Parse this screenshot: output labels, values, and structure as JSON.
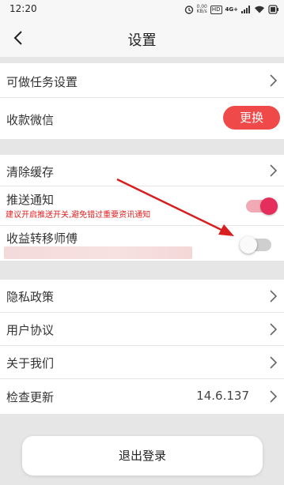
{
  "status_bar": {
    "time": "12:20",
    "speed_value": "0.00",
    "speed_unit": "KB/s",
    "hd_label": "HD",
    "network_label": "4G+"
  },
  "header": {
    "title": "设置",
    "back_icon": "chevron-left-icon"
  },
  "section1": {
    "task_settings_label": "可做任务设置",
    "wechat_label": "收款微信",
    "change_button_label": "更换"
  },
  "section2": {
    "clear_cache_label": "清除缓存",
    "push_label": "推送通知",
    "push_hint": "建议开启推送开关,避免错过重要资讯通知",
    "push_enabled": true,
    "transfer_label": "收益转移师傅",
    "transfer_enabled": false
  },
  "section3": {
    "privacy_label": "隐私政策",
    "agreement_label": "用户协议",
    "about_label": "关于我们",
    "update_label": "检查更新",
    "version": "14.6.137"
  },
  "logout_label": "退出登录",
  "colors": {
    "accent_red": "#ef4a49",
    "toggle_on": "#e52e5c",
    "hint_red": "#e02020",
    "arrow_red": "#d81e1e"
  }
}
